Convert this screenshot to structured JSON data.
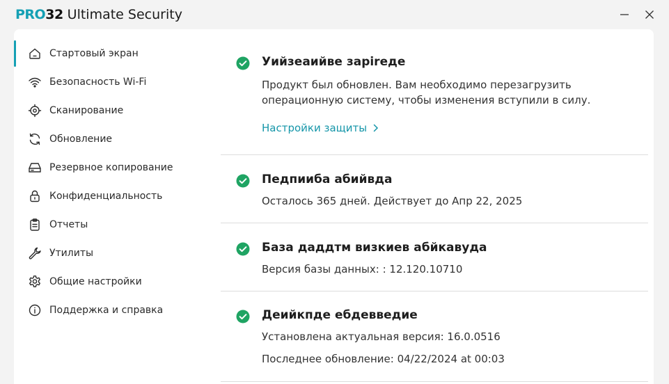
{
  "app": {
    "logo_prefix": "PRO",
    "logo_number": "32",
    "title": "Ultimate Security",
    "accent_color": "#15a0b4",
    "success_color": "#1fa463"
  },
  "window_controls": {
    "minimize_icon": "minimize-icon",
    "close_icon": "close-icon"
  },
  "sidebar": {
    "items": [
      {
        "label": "Стартовый экран",
        "icon": "home-icon",
        "active": true
      },
      {
        "label": "Безопасность Wi-Fi",
        "icon": "wifi-icon"
      },
      {
        "label": "Сканирование",
        "icon": "scan-target-icon"
      },
      {
        "label": "Обновление",
        "icon": "refresh-icon"
      },
      {
        "label": "Резервное копирование",
        "icon": "drive-icon"
      },
      {
        "label": "Конфиденциальность",
        "icon": "lock-icon"
      },
      {
        "label": "Отчеты",
        "icon": "clipboard-icon"
      },
      {
        "label": "Утилиты",
        "icon": "wrench-icon"
      },
      {
        "label": "Общие настройки",
        "icon": "gear-icon"
      },
      {
        "label": "Поддержка и справка",
        "icon": "info-icon"
      }
    ]
  },
  "status": {
    "protection": {
      "title": "Уийзеаийве зарireде",
      "text_line1": "Продукт был обновлен. Вам необходимо перезагрузить",
      "text_line2": "операционную систему, чтобы изменения вступили в силу.",
      "link": "Настройки защиты"
    },
    "subscription": {
      "title": "Педпииба абийвда",
      "text": "Осталось 365 дней. Действует до Апр 22, 2025"
    },
    "database": {
      "title": "База даддтм визкиев абйкавуда",
      "text": "Версия базы данных: : 12.120.10710"
    },
    "version": {
      "title": "Деийкпде ебдевведие",
      "text_line1": "Установлена актуальная версия: 16.0.0516",
      "text_line2": "Последнее обновление: 04/22/2024 at 00:03"
    }
  }
}
